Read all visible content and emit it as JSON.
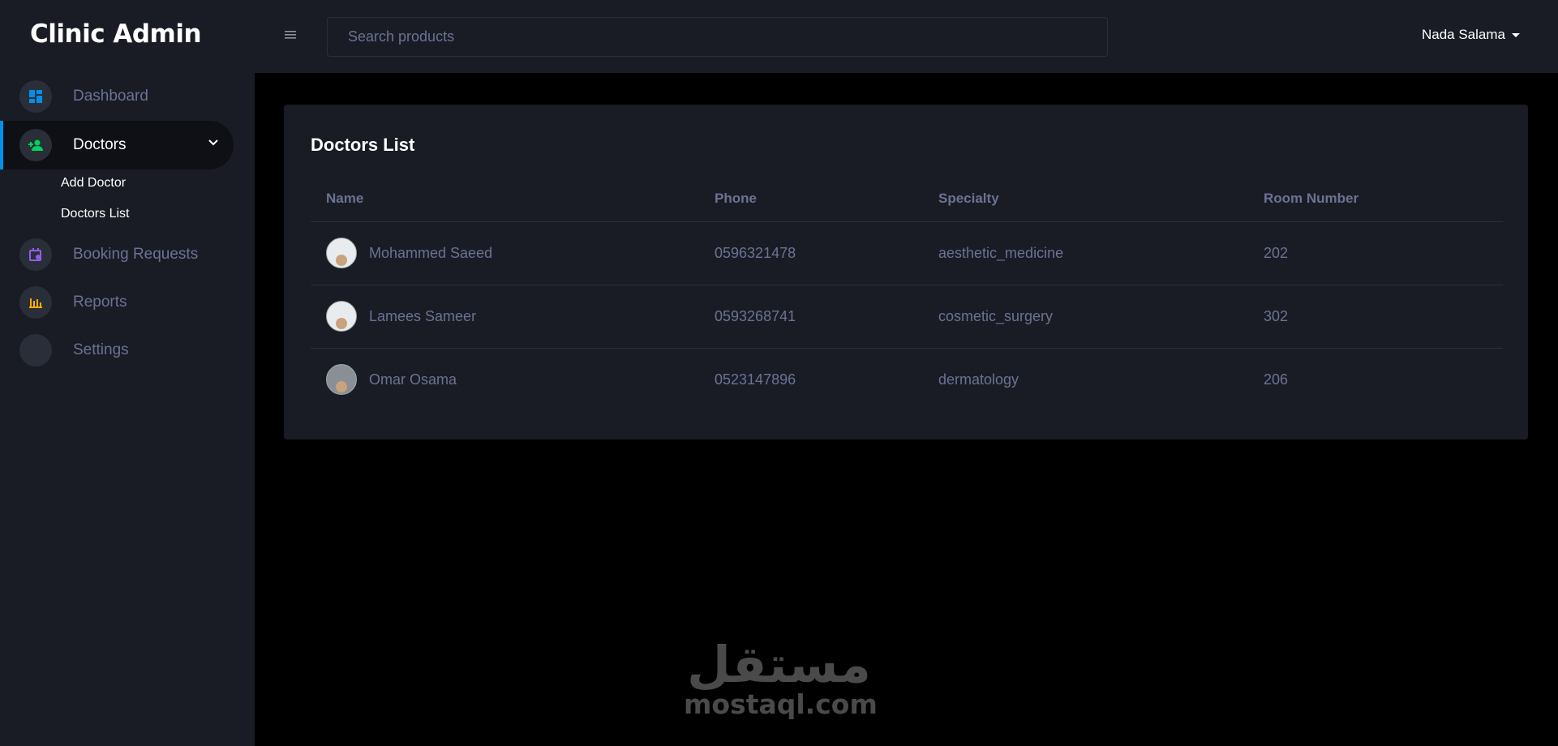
{
  "app": {
    "title": "Clinic Admin"
  },
  "sidebar": {
    "items": [
      {
        "label": "Dashboard",
        "icon": "dashboard-icon",
        "color": "#0090e7"
      },
      {
        "label": "Doctors",
        "icon": "doctors-icon",
        "color": "#00d25b",
        "active": true
      },
      {
        "label": "Booking Requests",
        "icon": "calendar-icon",
        "color": "#8f5fe8"
      },
      {
        "label": "Reports",
        "icon": "chart-icon",
        "color": "#ffab00"
      },
      {
        "label": "Settings",
        "icon": "settings-icon"
      }
    ],
    "submenu": [
      "Add Doctor",
      "Doctors List"
    ]
  },
  "header": {
    "search_placeholder": "Search products",
    "user_name": "Nada Salama"
  },
  "main": {
    "card_title": "Doctors List",
    "columns": [
      "Name",
      "Phone",
      "Specialty",
      "Room Number"
    ],
    "rows": [
      {
        "name": "Mohammed Saeed",
        "phone": "0596321478",
        "specialty": "aesthetic_medicine",
        "room": "202"
      },
      {
        "name": "Lamees Sameer",
        "phone": "0593268741",
        "specialty": "cosmetic_surgery",
        "room": "302"
      },
      {
        "name": "Omar Osama",
        "phone": "0523147896",
        "specialty": "dermatology",
        "room": "206"
      }
    ]
  },
  "watermark": {
    "arabic": "مستقل",
    "latin": "mostaql.com"
  }
}
